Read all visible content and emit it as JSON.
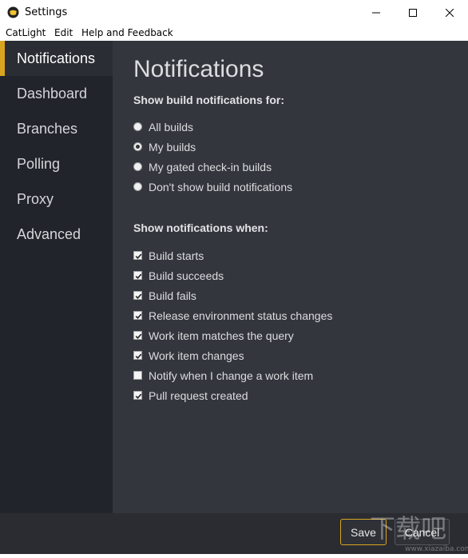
{
  "window": {
    "title": "Settings"
  },
  "menu": [
    "CatLight",
    "Edit",
    "Help and Feedback"
  ],
  "sidebar": {
    "items": [
      {
        "label": "Notifications",
        "active": true
      },
      {
        "label": "Dashboard"
      },
      {
        "label": "Branches"
      },
      {
        "label": "Polling"
      },
      {
        "label": "Proxy"
      },
      {
        "label": "Advanced"
      }
    ]
  },
  "main": {
    "title": "Notifications",
    "build_section": {
      "title": "Show build notifications for:",
      "options": [
        {
          "label": "All builds",
          "checked": false
        },
        {
          "label": "My builds",
          "checked": true
        },
        {
          "label": "My gated check-in builds",
          "checked": false
        },
        {
          "label": "Don't show build notifications",
          "checked": false
        }
      ]
    },
    "when_section": {
      "title": "Show notifications when:",
      "options": [
        {
          "label": "Build starts",
          "checked": true
        },
        {
          "label": "Build succeeds",
          "checked": true
        },
        {
          "label": "Build fails",
          "checked": true
        },
        {
          "label": "Release environment status changes",
          "checked": true
        },
        {
          "label": "Work item matches the query",
          "checked": true
        },
        {
          "label": "Work item changes",
          "checked": true
        },
        {
          "label": "Notify when I change a work item",
          "checked": false
        },
        {
          "label": "Pull request created",
          "checked": true
        }
      ]
    }
  },
  "footer": {
    "save_label": "Save",
    "cancel_label": "Cancel"
  },
  "watermark": {
    "text": "下载吧",
    "subtext": "www.xiazaiba.com"
  },
  "colors": {
    "accent": "#d9a521",
    "sidebar": "#22242b",
    "main": "#33363d"
  }
}
